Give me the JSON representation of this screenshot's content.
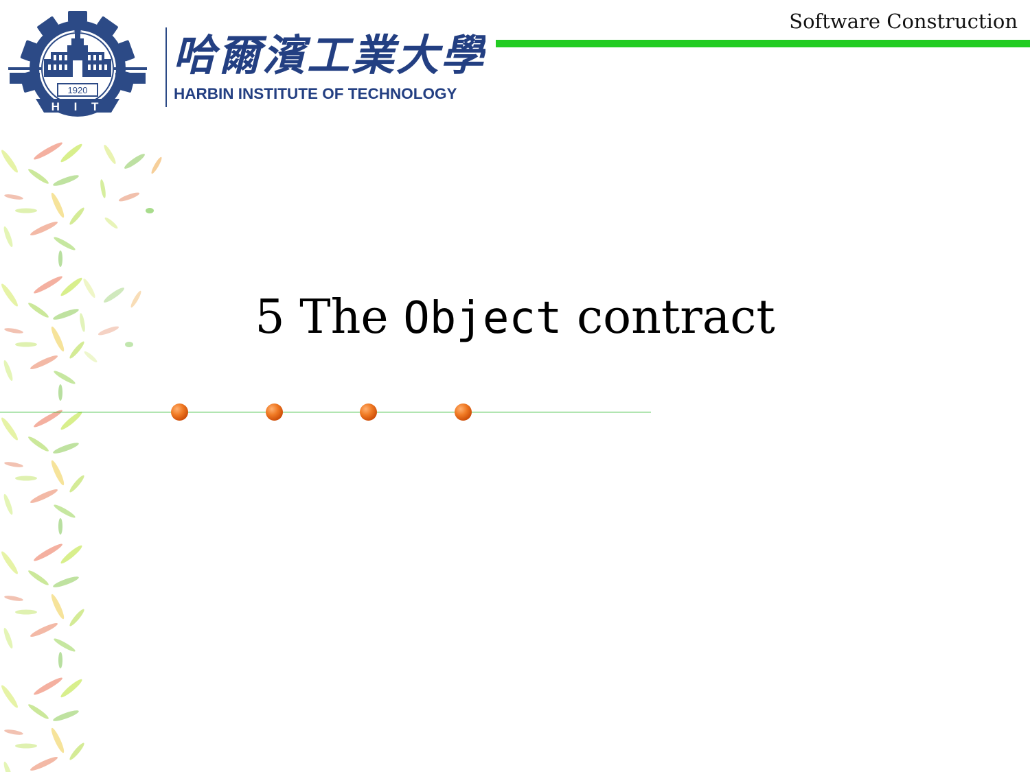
{
  "header": {
    "course_title": "Software Construction",
    "institution_name_chinese": "哈爾濱工業大學",
    "institution_name_english": "HARBIN INSTITUTE OF TECHNOLOGY",
    "emblem_year": "1920",
    "emblem_letters": "H I T"
  },
  "slide": {
    "title_prefix": "5 The",
    "title_code": "Object",
    "title_suffix": "contract"
  },
  "colors": {
    "accent_green": "#22cc22",
    "bullet_orange": "#f07a24",
    "logo_blue": "#233f82"
  }
}
